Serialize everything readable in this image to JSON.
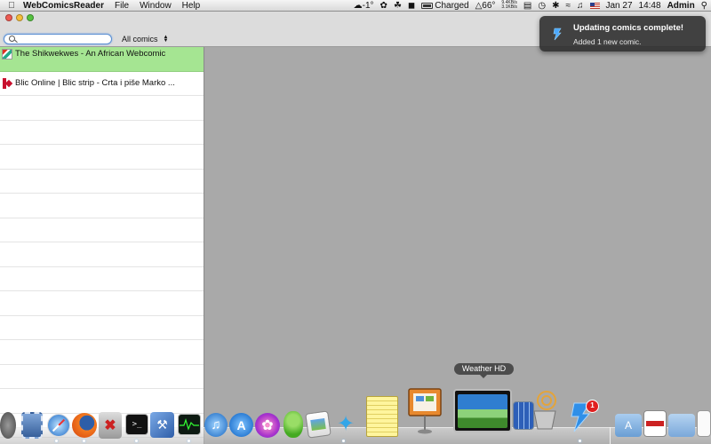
{
  "menubar": {
    "app_name": "WebComicsReader",
    "menus": [
      "File",
      "Window",
      "Help"
    ],
    "status": {
      "temperature": "-1°",
      "battery": "Charged",
      "cpu_temp": "66°",
      "net_up": "9.4KB/s",
      "net_down": "3.1KB/s",
      "date": "Jan 27",
      "time": "14:48",
      "user": "Admin"
    }
  },
  "toolbar": {
    "search": {
      "value": "",
      "placeholder": ""
    },
    "filter": {
      "selected": "All comics"
    }
  },
  "comics": [
    {
      "title": "The Shikwekwes - An African Webcomic",
      "selected": true,
      "icon": "shikwekwes-favicon"
    },
    {
      "title": "Blic Online | Blic strip - Crta i piše Marko ...",
      "selected": false,
      "icon": "blic-favicon"
    }
  ],
  "notification": {
    "title": "Updating comics complete!",
    "body": "Added 1 new comic."
  },
  "dock": {
    "tooltip": "Weather HD",
    "badge_count": "1",
    "colors": {
      "selected_row": "#a5e592",
      "accent": "#5b8fd1",
      "badge": "#e02020"
    }
  }
}
